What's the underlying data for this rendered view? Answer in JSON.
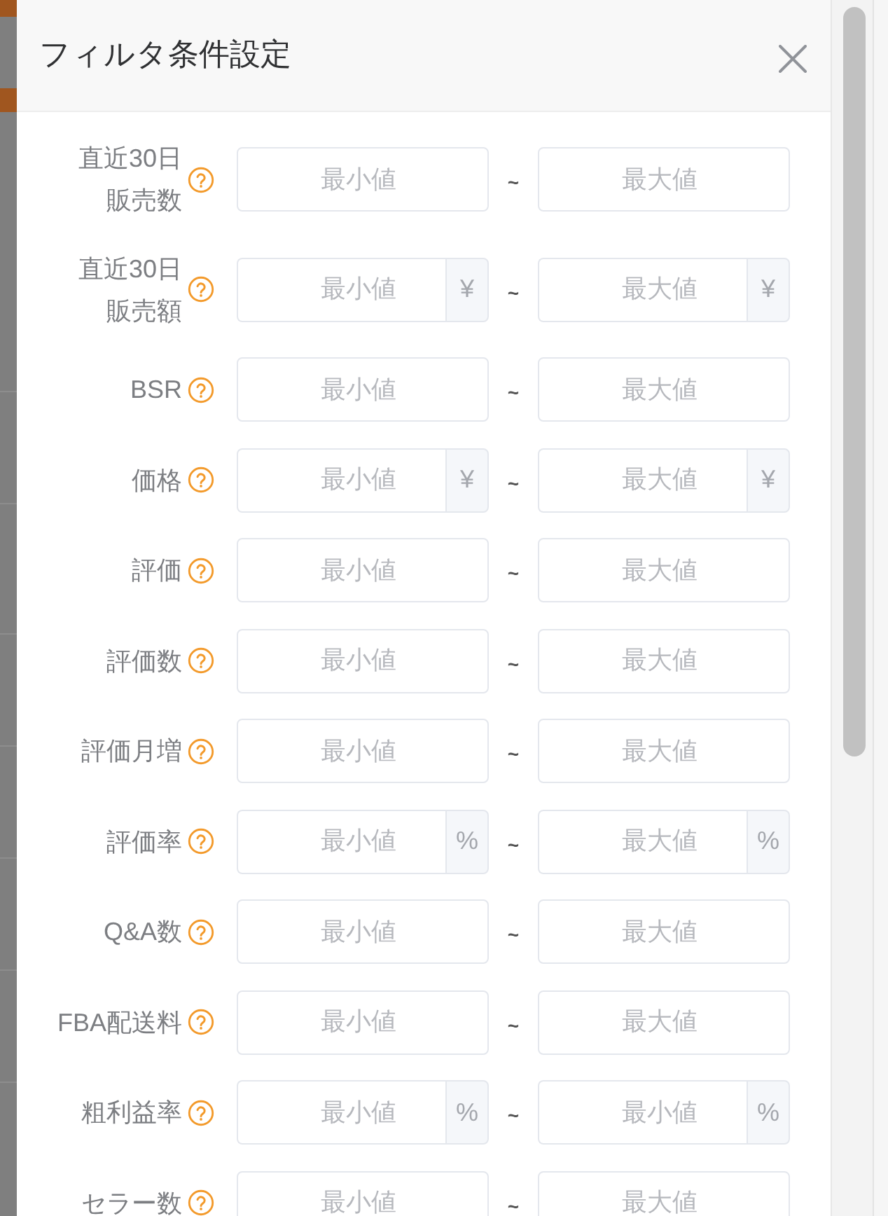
{
  "dialog": {
    "title": "フィルタ条件設定"
  },
  "filters": [
    {
      "label": "直近30日販売数",
      "min": {
        "placeholder": "最小値"
      },
      "separator": "~",
      "max": {
        "placeholder": "最大値"
      }
    },
    {
      "label": "直近30日販売額",
      "min": {
        "placeholder": "最小値",
        "unit": "¥"
      },
      "separator": "~",
      "max": {
        "placeholder": "最大値",
        "unit": "¥"
      }
    },
    {
      "label": "BSR",
      "min": {
        "placeholder": "最小値"
      },
      "separator": "~",
      "max": {
        "placeholder": "最大値"
      }
    },
    {
      "label": "価格",
      "min": {
        "placeholder": "最小値",
        "unit": "¥"
      },
      "separator": "~",
      "max": {
        "placeholder": "最大値",
        "unit": "¥"
      }
    },
    {
      "label": "評価",
      "min": {
        "placeholder": "最小値"
      },
      "separator": "~",
      "max": {
        "placeholder": "最大値"
      }
    },
    {
      "label": "評価数",
      "min": {
        "placeholder": "最小値"
      },
      "separator": "~",
      "max": {
        "placeholder": "最大値"
      }
    },
    {
      "label": "評価月増",
      "min": {
        "placeholder": "最小値"
      },
      "separator": "~",
      "max": {
        "placeholder": "最大値"
      }
    },
    {
      "label": "評価率",
      "min": {
        "placeholder": "最小値",
        "unit": "%"
      },
      "separator": "~",
      "max": {
        "placeholder": "最大値",
        "unit": "%"
      }
    },
    {
      "label": "Q&A数",
      "min": {
        "placeholder": "最小値"
      },
      "separator": "~",
      "max": {
        "placeholder": "最大値"
      }
    },
    {
      "label": "FBA配送料",
      "min": {
        "placeholder": "最小値"
      },
      "separator": "~",
      "max": {
        "placeholder": "最大値"
      }
    },
    {
      "label": "粗利益率",
      "min": {
        "placeholder": "最小値",
        "unit": "%"
      },
      "separator": "~",
      "max": {
        "placeholder": "最小値",
        "unit": "%"
      }
    },
    {
      "label": "セラー数",
      "min": {
        "placeholder": "最小値"
      },
      "separator": "~",
      "max": {
        "placeholder": "最大値"
      }
    }
  ]
}
